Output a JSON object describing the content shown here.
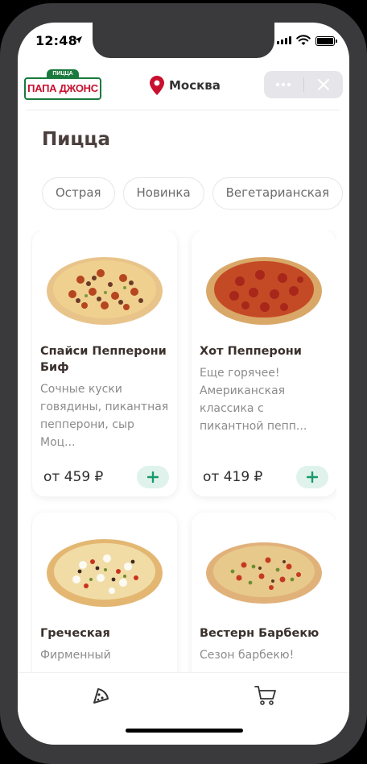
{
  "status_bar": {
    "time": "12:48"
  },
  "header": {
    "logo_top": "ПИЦЦА",
    "logo_main": "ПАПА ДЖОНС",
    "location": "Москва"
  },
  "section": {
    "title": "Пицца"
  },
  "filters": [
    "Острая",
    "Новинка",
    "Вегетарианская"
  ],
  "products": [
    {
      "name": "Спайси Пепперони Биф",
      "description": "Сочные куски говядины, пикантная пепперони, сыр Моц...",
      "price": "от 459 ₽"
    },
    {
      "name": "Хот Пепперони",
      "description": "Еще горячее! Американская классика с пикантной пепп...",
      "price": "от 419 ₽"
    },
    {
      "name": "Греческая",
      "description": "Фирменный",
      "price": ""
    },
    {
      "name": "Вестерн Барбекю",
      "description": "Сезон барбекю!",
      "price": ""
    }
  ],
  "tabs": [
    {
      "icon": "pizza-slice-icon"
    },
    {
      "icon": "cart-icon"
    }
  ],
  "colors": {
    "brand_red": "#c8102e",
    "brand_green": "#1a7a3d",
    "add_button_bg": "#dff3ec",
    "add_button_icon": "#1a9a6a",
    "title_text": "#4a3f3c"
  }
}
